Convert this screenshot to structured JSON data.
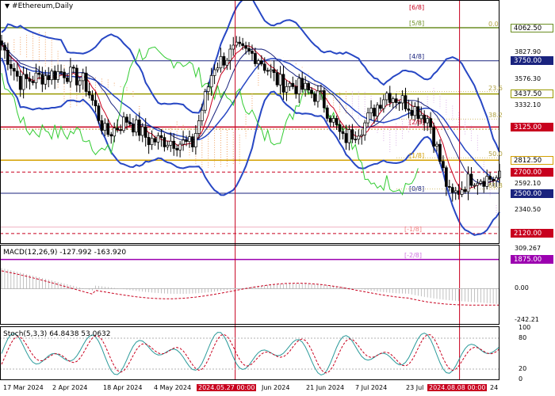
{
  "header": {
    "title": "#Ethereum,Daily"
  },
  "macd": {
    "label": "MACD(12,26,9)",
    "v1": "-127.992",
    "v2": "-163.920",
    "ticks": [
      "309.267",
      "0.00",
      "-242.21"
    ]
  },
  "stoch": {
    "label": "Stoch(5,3,3)",
    "v1": "64.8438",
    "v2": "53.0632",
    "ticks": [
      "100",
      "80",
      "20",
      "0"
    ]
  },
  "price_labels": [
    {
      "text": "4062.50",
      "bg": "#ffffff",
      "fg": "#000000",
      "border": "#6b8e23"
    },
    {
      "text": "3750.00",
      "bg": "#1a237e",
      "fg": "#ffffff",
      "border": "#1a237e"
    },
    {
      "text": "3437.50",
      "bg": "#ffffff",
      "fg": "#000000",
      "border": "#9a9a00"
    },
    {
      "text": "3125.00",
      "bg": "#c8001e",
      "fg": "#ffffff",
      "border": "#c8001e"
    },
    {
      "text": "2812.50",
      "bg": "#ffffff",
      "fg": "#000000",
      "border": "#d4a000"
    },
    {
      "text": "2700.00",
      "bg": "#c8001e",
      "fg": "#ffffff",
      "border": "#c8001e"
    },
    {
      "text": "2500.00",
      "bg": "#1a237e",
      "fg": "#ffffff",
      "border": "#1a237e"
    },
    {
      "text": "2120.00",
      "bg": "#c8001e",
      "fg": "#ffffff",
      "border": "#c8001e"
    },
    {
      "text": "1875.00",
      "bg": "#9c00b0",
      "fg": "#ffffff",
      "border": "#9c00b0"
    }
  ],
  "price_ticks": [
    "3827.90",
    "3576.30",
    "3332.10",
    "2592.10",
    "2340.50"
  ],
  "murrey_labels": [
    "[5/8]",
    "[4/8]",
    "[2/8]",
    "[1/8]",
    "[0/8]",
    "[-1/8]",
    "[-2/8]",
    "[6/8]"
  ],
  "fibo_labels": [
    "0.0",
    "23.6",
    "38.2",
    "50.0",
    "61.8"
  ],
  "x_labels": [
    "17 Mar 2024",
    "2 Apr 2024",
    "18 Apr 2024",
    "4 May 2024",
    "2024.05.27 00:00",
    "Jun 2024",
    "21 Jun 2024",
    "7 Jul 2024",
    "23 Jul",
    "2024.08.08 00:00",
    "24"
  ],
  "colors": {
    "bollinger": "#2747c4",
    "ma_fast": "#c8001e",
    "ma_slow": "#1a237e",
    "green": "#33cc33",
    "ichimoku": "#f0a060",
    "macd_signal": "#c8001e",
    "stoch_main": "#2a9a9a",
    "stoch_signal": "#c8001e"
  },
  "chart_data": {
    "type": "candlestick",
    "title": "#Ethereum,Daily",
    "x_range": [
      "2024-03-12",
      "2024-08-21"
    ],
    "ylim": [
      1840,
      4200
    ],
    "key_levels": [
      4062.5,
      3750.0,
      3437.5,
      3125.0,
      2812.5,
      2700.0,
      2500.0,
      2120.0,
      1875.0
    ],
    "vertical_markers": [
      "2024-05-27",
      "2024-08-08"
    ],
    "close_path": [
      {
        "date": "2024-03-12",
        "close": 3900
      },
      {
        "date": "2024-03-18",
        "close": 3550
      },
      {
        "date": "2024-03-25",
        "close": 3600
      },
      {
        "date": "2024-04-01",
        "close": 3650
      },
      {
        "date": "2024-04-08",
        "close": 3550
      },
      {
        "date": "2024-04-15",
        "close": 3050
      },
      {
        "date": "2024-04-22",
        "close": 3200
      },
      {
        "date": "2024-04-29",
        "close": 3000
      },
      {
        "date": "2024-05-06",
        "close": 3000
      },
      {
        "date": "2024-05-13",
        "close": 2950
      },
      {
        "date": "2024-05-20",
        "close": 3700
      },
      {
        "date": "2024-05-27",
        "close": 3850
      },
      {
        "date": "2024-06-03",
        "close": 3800
      },
      {
        "date": "2024-06-10",
        "close": 3550
      },
      {
        "date": "2024-06-17",
        "close": 3500
      },
      {
        "date": "2024-06-24",
        "close": 3400
      },
      {
        "date": "2024-07-01",
        "close": 3000
      },
      {
        "date": "2024-07-08",
        "close": 3150
      },
      {
        "date": "2024-07-15",
        "close": 3450
      },
      {
        "date": "2024-07-22",
        "close": 3350
      },
      {
        "date": "2024-07-29",
        "close": 3200
      },
      {
        "date": "2024-08-05",
        "close": 2450
      },
      {
        "date": "2024-08-12",
        "close": 2650
      },
      {
        "date": "2024-08-19",
        "close": 2640
      }
    ],
    "macd": {
      "main": -127.992,
      "signal": -163.92,
      "ylim": [
        -242.21,
        309.267
      ]
    },
    "stochastic": {
      "k": 64.8438,
      "d": 53.0632,
      "levels": [
        80,
        20
      ],
      "ylim": [
        0,
        100
      ]
    }
  }
}
